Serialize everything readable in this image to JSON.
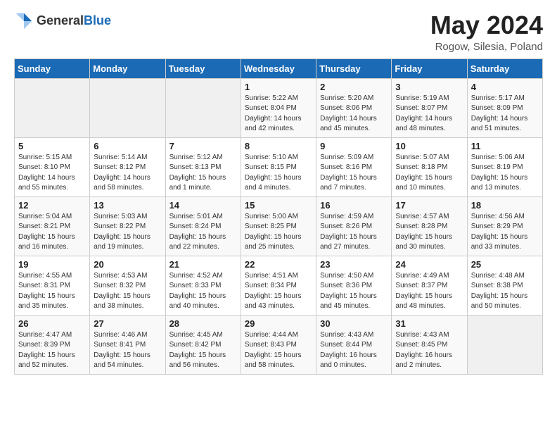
{
  "header": {
    "logo_general": "General",
    "logo_blue": "Blue",
    "month": "May 2024",
    "location": "Rogow, Silesia, Poland"
  },
  "days_of_week": [
    "Sunday",
    "Monday",
    "Tuesday",
    "Wednesday",
    "Thursday",
    "Friday",
    "Saturday"
  ],
  "weeks": [
    [
      {
        "day": "",
        "sunrise": "",
        "sunset": "",
        "daylight": ""
      },
      {
        "day": "",
        "sunrise": "",
        "sunset": "",
        "daylight": ""
      },
      {
        "day": "",
        "sunrise": "",
        "sunset": "",
        "daylight": ""
      },
      {
        "day": "1",
        "sunrise": "Sunrise: 5:22 AM",
        "sunset": "Sunset: 8:04 PM",
        "daylight": "Daylight: 14 hours and 42 minutes."
      },
      {
        "day": "2",
        "sunrise": "Sunrise: 5:20 AM",
        "sunset": "Sunset: 8:06 PM",
        "daylight": "Daylight: 14 hours and 45 minutes."
      },
      {
        "day": "3",
        "sunrise": "Sunrise: 5:19 AM",
        "sunset": "Sunset: 8:07 PM",
        "daylight": "Daylight: 14 hours and 48 minutes."
      },
      {
        "day": "4",
        "sunrise": "Sunrise: 5:17 AM",
        "sunset": "Sunset: 8:09 PM",
        "daylight": "Daylight: 14 hours and 51 minutes."
      }
    ],
    [
      {
        "day": "5",
        "sunrise": "Sunrise: 5:15 AM",
        "sunset": "Sunset: 8:10 PM",
        "daylight": "Daylight: 14 hours and 55 minutes."
      },
      {
        "day": "6",
        "sunrise": "Sunrise: 5:14 AM",
        "sunset": "Sunset: 8:12 PM",
        "daylight": "Daylight: 14 hours and 58 minutes."
      },
      {
        "day": "7",
        "sunrise": "Sunrise: 5:12 AM",
        "sunset": "Sunset: 8:13 PM",
        "daylight": "Daylight: 15 hours and 1 minute."
      },
      {
        "day": "8",
        "sunrise": "Sunrise: 5:10 AM",
        "sunset": "Sunset: 8:15 PM",
        "daylight": "Daylight: 15 hours and 4 minutes."
      },
      {
        "day": "9",
        "sunrise": "Sunrise: 5:09 AM",
        "sunset": "Sunset: 8:16 PM",
        "daylight": "Daylight: 15 hours and 7 minutes."
      },
      {
        "day": "10",
        "sunrise": "Sunrise: 5:07 AM",
        "sunset": "Sunset: 8:18 PM",
        "daylight": "Daylight: 15 hours and 10 minutes."
      },
      {
        "day": "11",
        "sunrise": "Sunrise: 5:06 AM",
        "sunset": "Sunset: 8:19 PM",
        "daylight": "Daylight: 15 hours and 13 minutes."
      }
    ],
    [
      {
        "day": "12",
        "sunrise": "Sunrise: 5:04 AM",
        "sunset": "Sunset: 8:21 PM",
        "daylight": "Daylight: 15 hours and 16 minutes."
      },
      {
        "day": "13",
        "sunrise": "Sunrise: 5:03 AM",
        "sunset": "Sunset: 8:22 PM",
        "daylight": "Daylight: 15 hours and 19 minutes."
      },
      {
        "day": "14",
        "sunrise": "Sunrise: 5:01 AM",
        "sunset": "Sunset: 8:24 PM",
        "daylight": "Daylight: 15 hours and 22 minutes."
      },
      {
        "day": "15",
        "sunrise": "Sunrise: 5:00 AM",
        "sunset": "Sunset: 8:25 PM",
        "daylight": "Daylight: 15 hours and 25 minutes."
      },
      {
        "day": "16",
        "sunrise": "Sunrise: 4:59 AM",
        "sunset": "Sunset: 8:26 PM",
        "daylight": "Daylight: 15 hours and 27 minutes."
      },
      {
        "day": "17",
        "sunrise": "Sunrise: 4:57 AM",
        "sunset": "Sunset: 8:28 PM",
        "daylight": "Daylight: 15 hours and 30 minutes."
      },
      {
        "day": "18",
        "sunrise": "Sunrise: 4:56 AM",
        "sunset": "Sunset: 8:29 PM",
        "daylight": "Daylight: 15 hours and 33 minutes."
      }
    ],
    [
      {
        "day": "19",
        "sunrise": "Sunrise: 4:55 AM",
        "sunset": "Sunset: 8:31 PM",
        "daylight": "Daylight: 15 hours and 35 minutes."
      },
      {
        "day": "20",
        "sunrise": "Sunrise: 4:53 AM",
        "sunset": "Sunset: 8:32 PM",
        "daylight": "Daylight: 15 hours and 38 minutes."
      },
      {
        "day": "21",
        "sunrise": "Sunrise: 4:52 AM",
        "sunset": "Sunset: 8:33 PM",
        "daylight": "Daylight: 15 hours and 40 minutes."
      },
      {
        "day": "22",
        "sunrise": "Sunrise: 4:51 AM",
        "sunset": "Sunset: 8:34 PM",
        "daylight": "Daylight: 15 hours and 43 minutes."
      },
      {
        "day": "23",
        "sunrise": "Sunrise: 4:50 AM",
        "sunset": "Sunset: 8:36 PM",
        "daylight": "Daylight: 15 hours and 45 minutes."
      },
      {
        "day": "24",
        "sunrise": "Sunrise: 4:49 AM",
        "sunset": "Sunset: 8:37 PM",
        "daylight": "Daylight: 15 hours and 48 minutes."
      },
      {
        "day": "25",
        "sunrise": "Sunrise: 4:48 AM",
        "sunset": "Sunset: 8:38 PM",
        "daylight": "Daylight: 15 hours and 50 minutes."
      }
    ],
    [
      {
        "day": "26",
        "sunrise": "Sunrise: 4:47 AM",
        "sunset": "Sunset: 8:39 PM",
        "daylight": "Daylight: 15 hours and 52 minutes."
      },
      {
        "day": "27",
        "sunrise": "Sunrise: 4:46 AM",
        "sunset": "Sunset: 8:41 PM",
        "daylight": "Daylight: 15 hours and 54 minutes."
      },
      {
        "day": "28",
        "sunrise": "Sunrise: 4:45 AM",
        "sunset": "Sunset: 8:42 PM",
        "daylight": "Daylight: 15 hours and 56 minutes."
      },
      {
        "day": "29",
        "sunrise": "Sunrise: 4:44 AM",
        "sunset": "Sunset: 8:43 PM",
        "daylight": "Daylight: 15 hours and 58 minutes."
      },
      {
        "day": "30",
        "sunrise": "Sunrise: 4:43 AM",
        "sunset": "Sunset: 8:44 PM",
        "daylight": "Daylight: 16 hours and 0 minutes."
      },
      {
        "day": "31",
        "sunrise": "Sunrise: 4:43 AM",
        "sunset": "Sunset: 8:45 PM",
        "daylight": "Daylight: 16 hours and 2 minutes."
      },
      {
        "day": "",
        "sunrise": "",
        "sunset": "",
        "daylight": ""
      }
    ]
  ]
}
